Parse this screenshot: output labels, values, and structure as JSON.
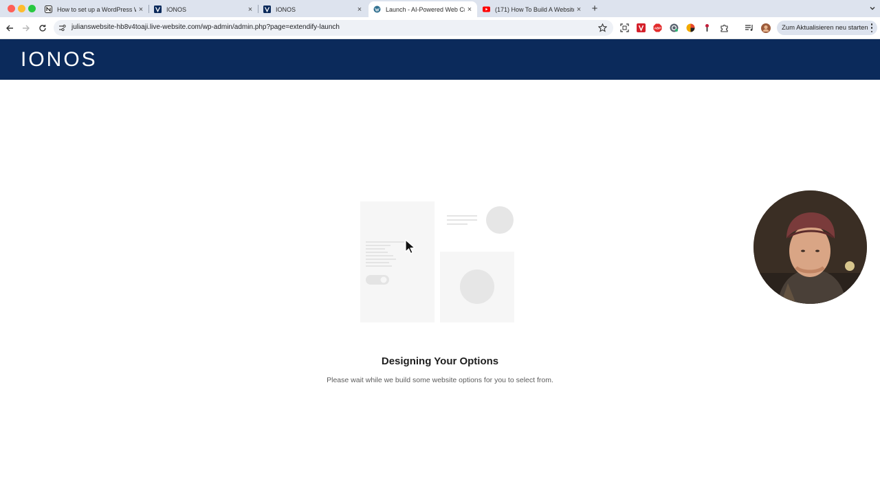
{
  "browser": {
    "tabs": [
      {
        "title": "How to set up a WordPress W",
        "favicon": "notion-icon",
        "active": false
      },
      {
        "title": "IONOS",
        "favicon": "ionos-icon",
        "active": false
      },
      {
        "title": "IONOS",
        "favicon": "ionos-icon",
        "active": false
      },
      {
        "title": "Launch - AI-Powered Web Cr",
        "favicon": "wordpress-icon",
        "active": true
      },
      {
        "title": "(171) How To Build A Website",
        "favicon": "youtube-icon",
        "active": false
      }
    ],
    "url": "julianswebsite-hb8v4toaji.live-website.com/wp-admin/admin.php?page=extendify-launch",
    "update_button": "Zum Aktualisieren neu starten"
  },
  "header": {
    "logo": "IONOS"
  },
  "main": {
    "heading": "Designing Your Options",
    "subtext": "Please wait while we build some website options for you to select from."
  },
  "colors": {
    "header_bg": "#0b2a5b",
    "tabstrip_bg": "#dde3ee",
    "placeholder": "#e6e6e6"
  }
}
